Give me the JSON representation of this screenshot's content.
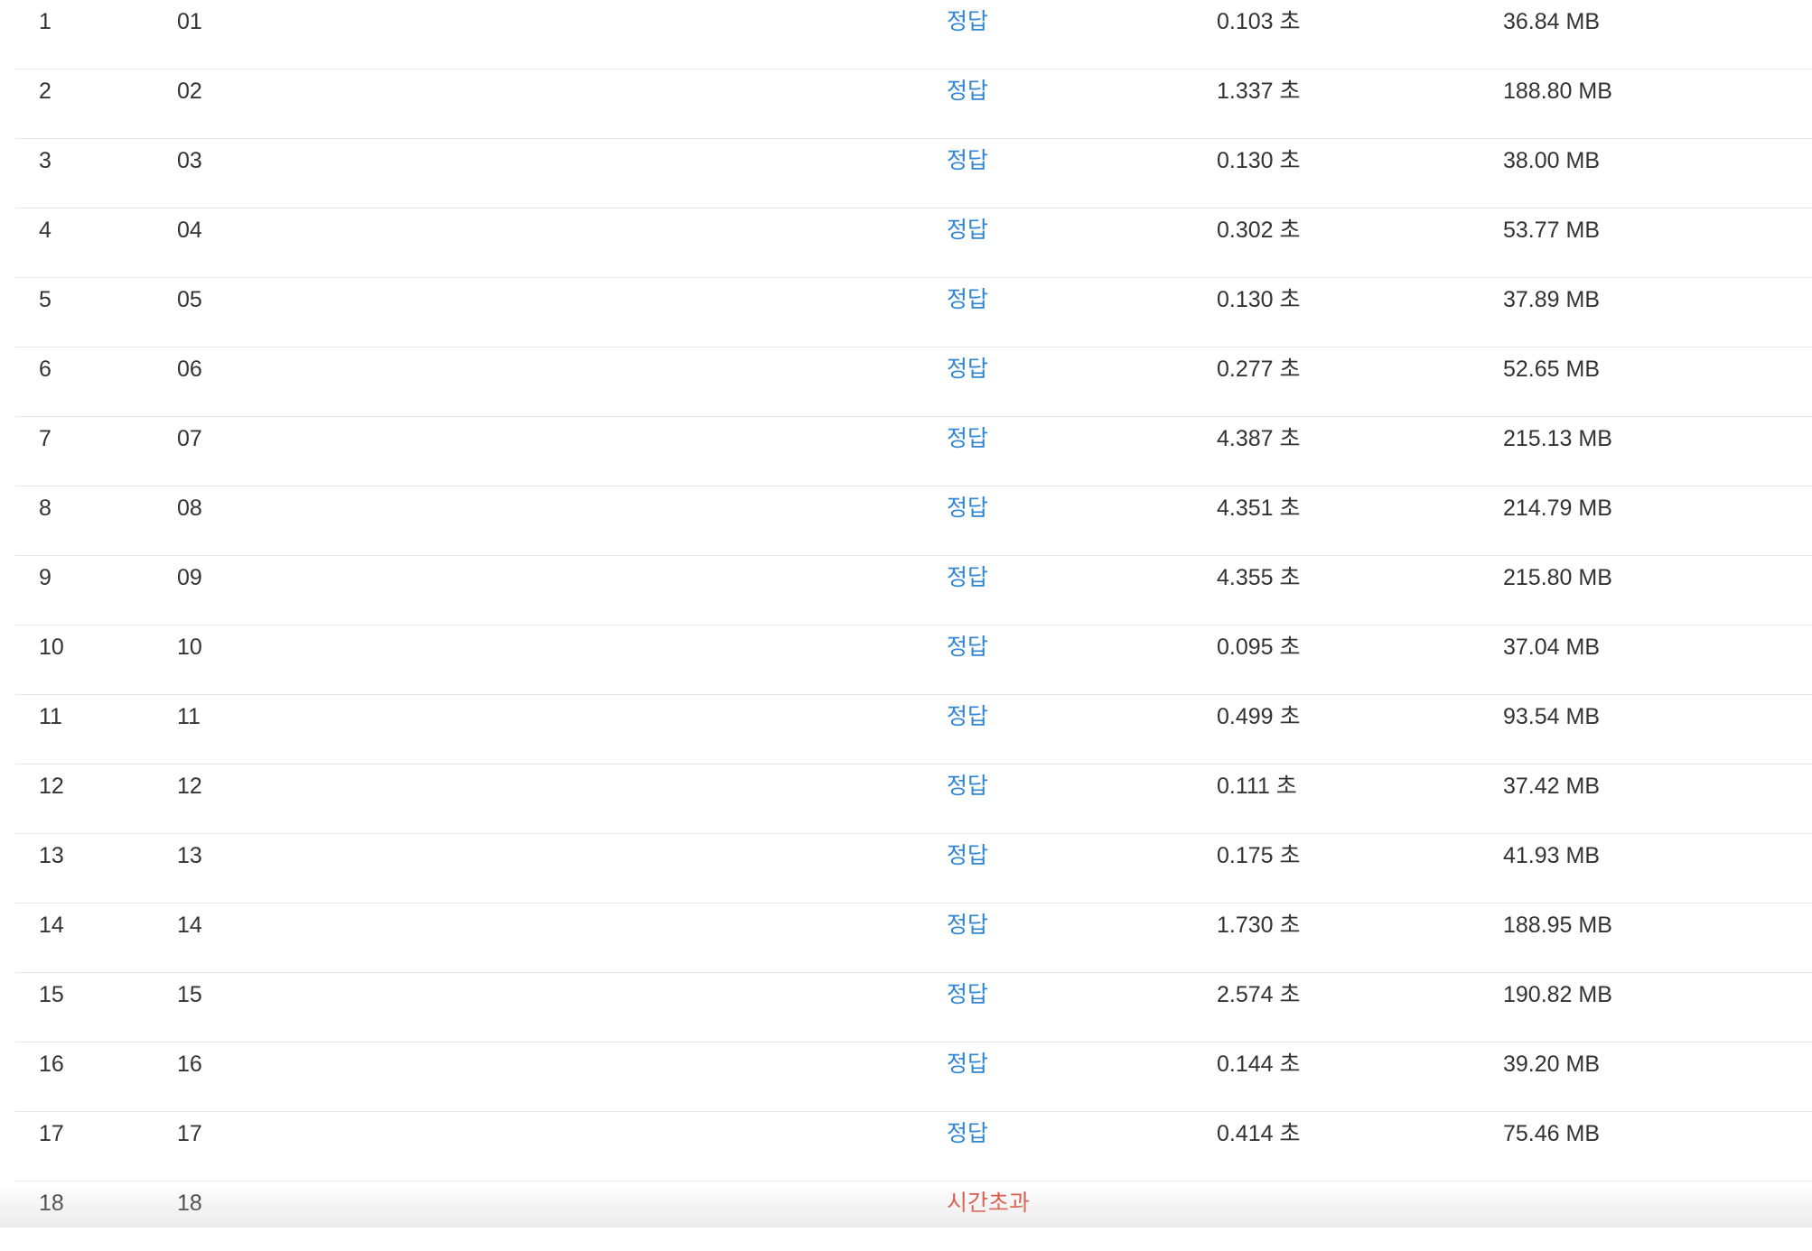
{
  "colors": {
    "accepted": "#2f86d6",
    "time_limit_exceeded": "#dd4b39",
    "text": "#333333",
    "divider": "#e6e6e6"
  },
  "rows": [
    {
      "index": "1",
      "name": "01",
      "result": "정답",
      "status": "ok",
      "time": "0.103 초",
      "memory": "36.84 MB"
    },
    {
      "index": "2",
      "name": "02",
      "result": "정답",
      "status": "ok",
      "time": "1.337 초",
      "memory": "188.80 MB"
    },
    {
      "index": "3",
      "name": "03",
      "result": "정답",
      "status": "ok",
      "time": "0.130 초",
      "memory": "38.00 MB"
    },
    {
      "index": "4",
      "name": "04",
      "result": "정답",
      "status": "ok",
      "time": "0.302 초",
      "memory": "53.77 MB"
    },
    {
      "index": "5",
      "name": "05",
      "result": "정답",
      "status": "ok",
      "time": "0.130 초",
      "memory": "37.89 MB"
    },
    {
      "index": "6",
      "name": "06",
      "result": "정답",
      "status": "ok",
      "time": "0.277 초",
      "memory": "52.65 MB"
    },
    {
      "index": "7",
      "name": "07",
      "result": "정답",
      "status": "ok",
      "time": "4.387 초",
      "memory": "215.13 MB"
    },
    {
      "index": "8",
      "name": "08",
      "result": "정답",
      "status": "ok",
      "time": "4.351 초",
      "memory": "214.79 MB"
    },
    {
      "index": "9",
      "name": "09",
      "result": "정답",
      "status": "ok",
      "time": "4.355 초",
      "memory": "215.80 MB"
    },
    {
      "index": "10",
      "name": "10",
      "result": "정답",
      "status": "ok",
      "time": "0.095 초",
      "memory": "37.04 MB"
    },
    {
      "index": "11",
      "name": "11",
      "result": "정답",
      "status": "ok",
      "time": "0.499 초",
      "memory": "93.54 MB"
    },
    {
      "index": "12",
      "name": "12",
      "result": "정답",
      "status": "ok",
      "time": "0.111 초",
      "memory": "37.42 MB"
    },
    {
      "index": "13",
      "name": "13",
      "result": "정답",
      "status": "ok",
      "time": "0.175 초",
      "memory": "41.93 MB"
    },
    {
      "index": "14",
      "name": "14",
      "result": "정답",
      "status": "ok",
      "time": "1.730 초",
      "memory": "188.95 MB"
    },
    {
      "index": "15",
      "name": "15",
      "result": "정답",
      "status": "ok",
      "time": "2.574 초",
      "memory": "190.82 MB"
    },
    {
      "index": "16",
      "name": "16",
      "result": "정답",
      "status": "ok",
      "time": "0.144 초",
      "memory": "39.20 MB"
    },
    {
      "index": "17",
      "name": "17",
      "result": "정답",
      "status": "ok",
      "time": "0.414 초",
      "memory": "75.46 MB"
    },
    {
      "index": "18",
      "name": "18",
      "result": "시간초과",
      "status": "tle",
      "time": "",
      "memory": ""
    }
  ]
}
